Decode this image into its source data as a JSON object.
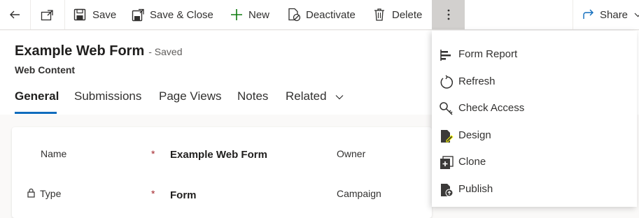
{
  "toolbar": {
    "save": "Save",
    "save_close": "Save & Close",
    "new": "New",
    "deactivate": "Deactivate",
    "delete": "Delete",
    "share": "Share"
  },
  "record": {
    "title": "Example Web Form",
    "status": "- Saved",
    "entity": "Web Content"
  },
  "tabs": [
    {
      "label": "General"
    },
    {
      "label": "Submissions"
    },
    {
      "label": "Page Views"
    },
    {
      "label": "Notes"
    },
    {
      "label": "Related"
    }
  ],
  "form": {
    "name_label": "Name",
    "name_value": "Example Web Form",
    "type_label": "Type",
    "type_value": "Form",
    "owner_label": "Owner",
    "campaign_label": "Campaign",
    "required_marker": "*"
  },
  "menu": {
    "items": [
      {
        "label": "Form Report",
        "icon": "form-report-icon"
      },
      {
        "label": "Refresh",
        "icon": "refresh-icon"
      },
      {
        "label": "Check Access",
        "icon": "key-icon"
      },
      {
        "label": "Design",
        "icon": "design-icon",
        "highlight": "#ffff00"
      },
      {
        "label": "Clone",
        "icon": "clone-icon"
      },
      {
        "label": "Publish",
        "icon": "publish-icon"
      }
    ]
  },
  "colors": {
    "accent": "#0f6cbd",
    "highlight": "#ffff00",
    "new_icon": "#107c10",
    "required": "#a4262c"
  }
}
